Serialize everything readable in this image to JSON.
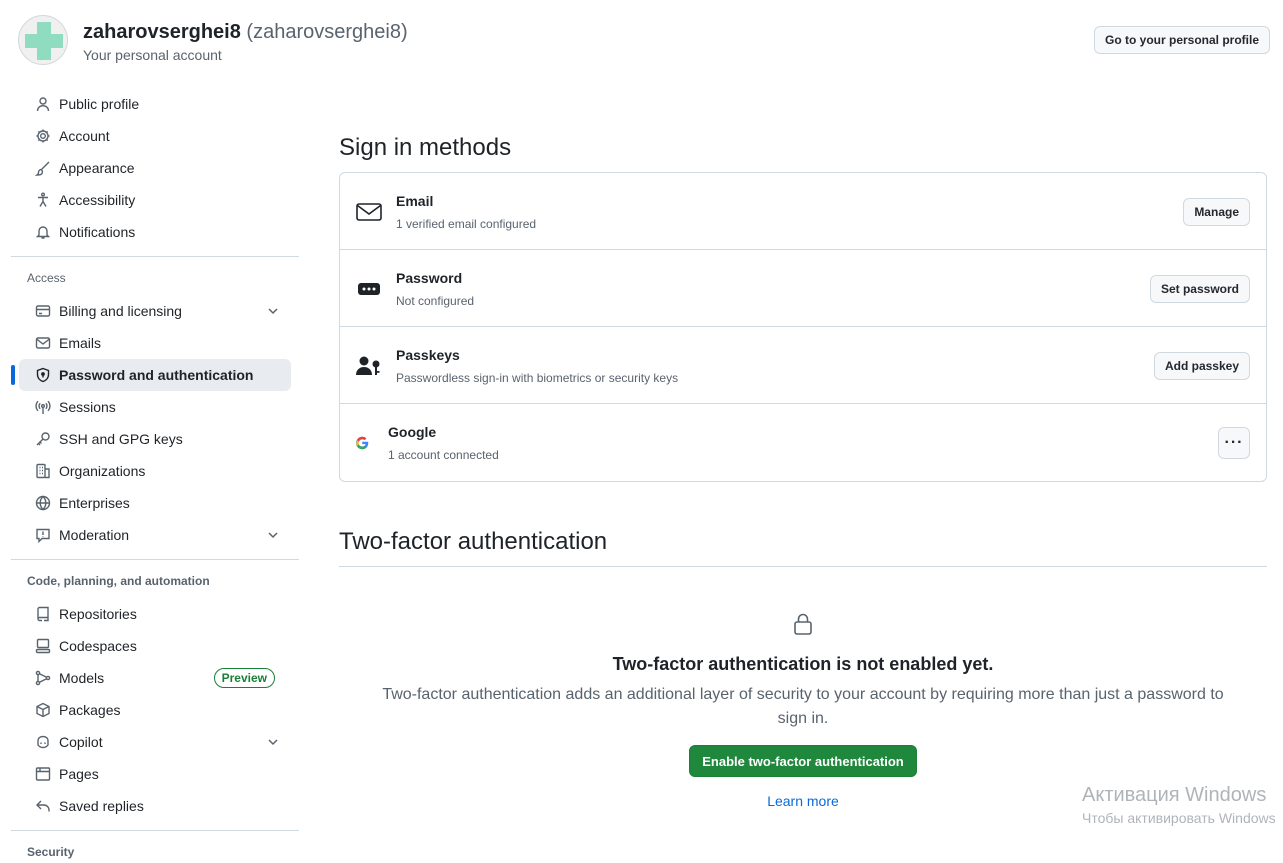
{
  "header": {
    "login": "zaharovserghei8",
    "handle": "(zaharovserghei8)",
    "subtitle": "Your personal account",
    "profile_button": "Go to your personal profile"
  },
  "sidebar": {
    "items_top": [
      {
        "label": "Public profile",
        "icon": "person-icon"
      },
      {
        "label": "Account",
        "icon": "gear-icon"
      },
      {
        "label": "Appearance",
        "icon": "paintbrush-icon"
      },
      {
        "label": "Accessibility",
        "icon": "accessibility-icon"
      },
      {
        "label": "Notifications",
        "icon": "bell-icon"
      }
    ],
    "group_access": "Access",
    "items_access": [
      {
        "label": "Billing and licensing",
        "icon": "credit-card-icon",
        "expandable": true
      },
      {
        "label": "Emails",
        "icon": "mail-icon"
      },
      {
        "label": "Password and authentication",
        "icon": "shield-lock-icon",
        "active": true
      },
      {
        "label": "Sessions",
        "icon": "broadcast-icon"
      },
      {
        "label": "SSH and GPG keys",
        "icon": "key-icon"
      },
      {
        "label": "Organizations",
        "icon": "organization-icon"
      },
      {
        "label": "Enterprises",
        "icon": "globe-icon"
      },
      {
        "label": "Moderation",
        "icon": "report-icon",
        "expandable": true
      }
    ],
    "group_code": "Code, planning, and automation",
    "items_code": [
      {
        "label": "Repositories",
        "icon": "repo-icon"
      },
      {
        "label": "Codespaces",
        "icon": "codespaces-icon"
      },
      {
        "label": "Models",
        "icon": "models-icon",
        "badge": "Preview"
      },
      {
        "label": "Packages",
        "icon": "package-icon"
      },
      {
        "label": "Copilot",
        "icon": "copilot-icon",
        "expandable": true
      },
      {
        "label": "Pages",
        "icon": "browser-icon"
      },
      {
        "label": "Saved replies",
        "icon": "reply-icon"
      }
    ],
    "group_security": "Security"
  },
  "signin": {
    "title": "Sign in methods",
    "methods": [
      {
        "name": "Email",
        "desc": "1 verified email configured",
        "button": "Manage",
        "icon": "mail-icon"
      },
      {
        "name": "Password",
        "desc": "Not configured",
        "button": "Set password",
        "icon": "password-icon"
      },
      {
        "name": "Passkeys",
        "desc": "Passwordless sign-in with biometrics or security keys",
        "button": "Add passkey",
        "icon": "passkey-icon"
      },
      {
        "name": "Google",
        "desc": "1 account connected",
        "button": "···",
        "icon": "google-icon"
      }
    ]
  },
  "twofa": {
    "title": "Two-factor authentication",
    "heading": "Two-factor authentication is not enabled yet.",
    "description": "Two-factor authentication adds an additional layer of security to your account by requiring more than just a password to sign in.",
    "enable_button": "Enable two-factor authentication",
    "learn_more": "Learn more"
  },
  "watermark": {
    "line1": "Активация Windows",
    "line2": "Чтобы активировать Windows"
  },
  "colors": {
    "accent": "#0969da",
    "primary_button": "#1f883d",
    "active_nav_bg": "#e8ebef"
  }
}
